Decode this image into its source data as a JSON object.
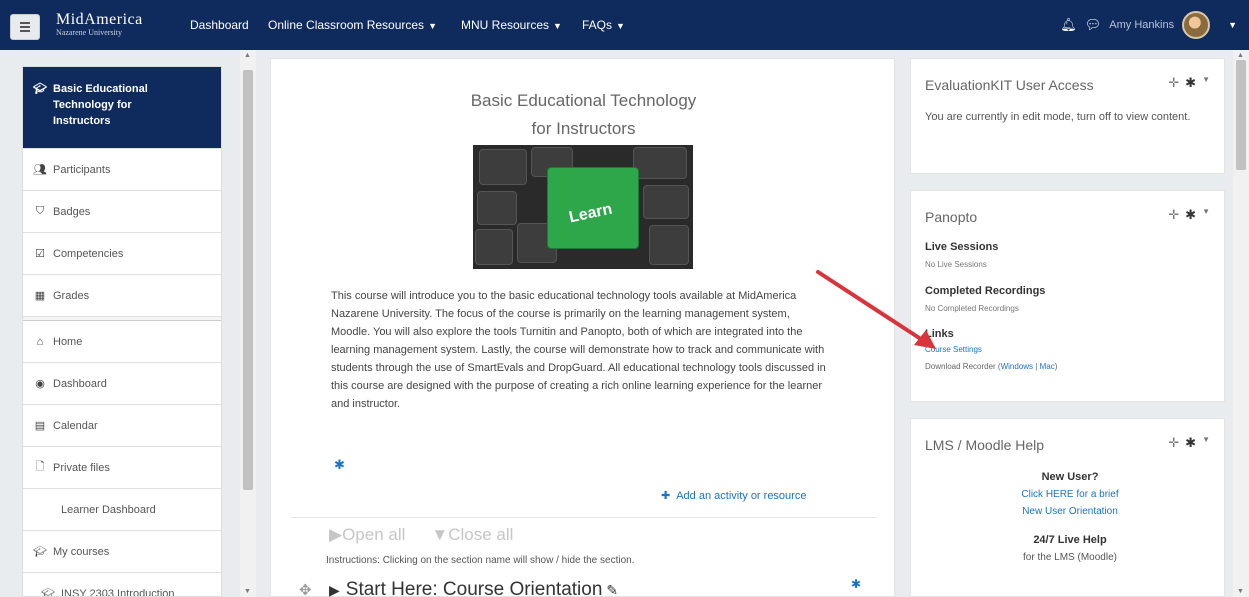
{
  "navbar": {
    "brand_line1": "MidAmerica",
    "brand_line2": "Nazarene University",
    "links": [
      {
        "label": "Dashboard"
      },
      {
        "label": "Online Classroom Resources"
      },
      {
        "label": "MNU Resources"
      },
      {
        "label": "FAQs"
      }
    ],
    "user_name": "Amy Hankins",
    "icons": [
      "menu-icon",
      "bell-icon",
      "chat-icon",
      "caret-down-icon"
    ]
  },
  "drawer": {
    "course_title": "Basic Educational Technology for Instructors",
    "items": [
      {
        "label": "Participants",
        "icon": "users-icon"
      },
      {
        "label": "Badges",
        "icon": "shield-icon"
      },
      {
        "label": "Competencies",
        "icon": "checkbox-icon"
      },
      {
        "label": "Grades",
        "icon": "table-icon"
      },
      {
        "label": "Home",
        "icon": "home-icon"
      },
      {
        "label": "Dashboard",
        "icon": "dashboard-icon"
      },
      {
        "label": "Calendar",
        "icon": "calendar-icon"
      },
      {
        "label": "Private files",
        "icon": "file-icon"
      },
      {
        "label": "Learner Dashboard",
        "icon": ""
      },
      {
        "label": "My courses",
        "icon": "graduation-cap-icon"
      },
      {
        "label": "INSY 2303 Introduction",
        "icon": "graduation-cap-icon"
      }
    ]
  },
  "main": {
    "title_line1": "Basic Educational Technology",
    "title_line2": "for Instructors",
    "image_key_text": "Learn",
    "summary": "This course will introduce you to the basic educational technology tools available at MidAmerica Nazarene University. The focus of the course is primarily on the learning management system, Moodle. You will also explore the tools Turnitin and Panopto, both of which are integrated into the learning management system. Lastly, the course will demonstrate how to track and communicate with students through the use of SmartEvals and DropGuard. All educational technology tools discussed in this course are designed with the purpose of creating a rich online learning experience for the learner and instructor.",
    "add_activity": "Add an activity or resource",
    "open_all": "Open all",
    "close_all": "Close all",
    "instructions": "Instructions: Clicking on the section name will show / hide the section.",
    "section_name": "Start Here: Course Orientation"
  },
  "blocks": {
    "evaluationkit": {
      "title": "EvaluationKIT User Access",
      "text": "You are currently in edit mode, turn off to view content."
    },
    "panopto": {
      "title": "Panopto",
      "live_heading": "Live Sessions",
      "live_text": "No Live Sessions",
      "completed_heading": "Completed Recordings",
      "completed_text": "No Completed Recordings",
      "links_heading": "Links",
      "course_settings": "Course Settings",
      "download_label": "Download Recorder",
      "download_windows": "Windows",
      "download_mac": "Mac"
    },
    "lms_help": {
      "title": "LMS / Moodle Help",
      "new_user": "New User?",
      "orientation_link_1": "Click HERE for a brief",
      "orientation_link_2": "New User Orientation",
      "live_help": "24/7 Live Help",
      "live_help_sub": "for the LMS (Moodle)"
    }
  },
  "colors": {
    "navbar": "#0f2a5c",
    "link": "#1a73c7",
    "annotation_arrow": "#d9333b",
    "key_green": "#2ea64a"
  }
}
